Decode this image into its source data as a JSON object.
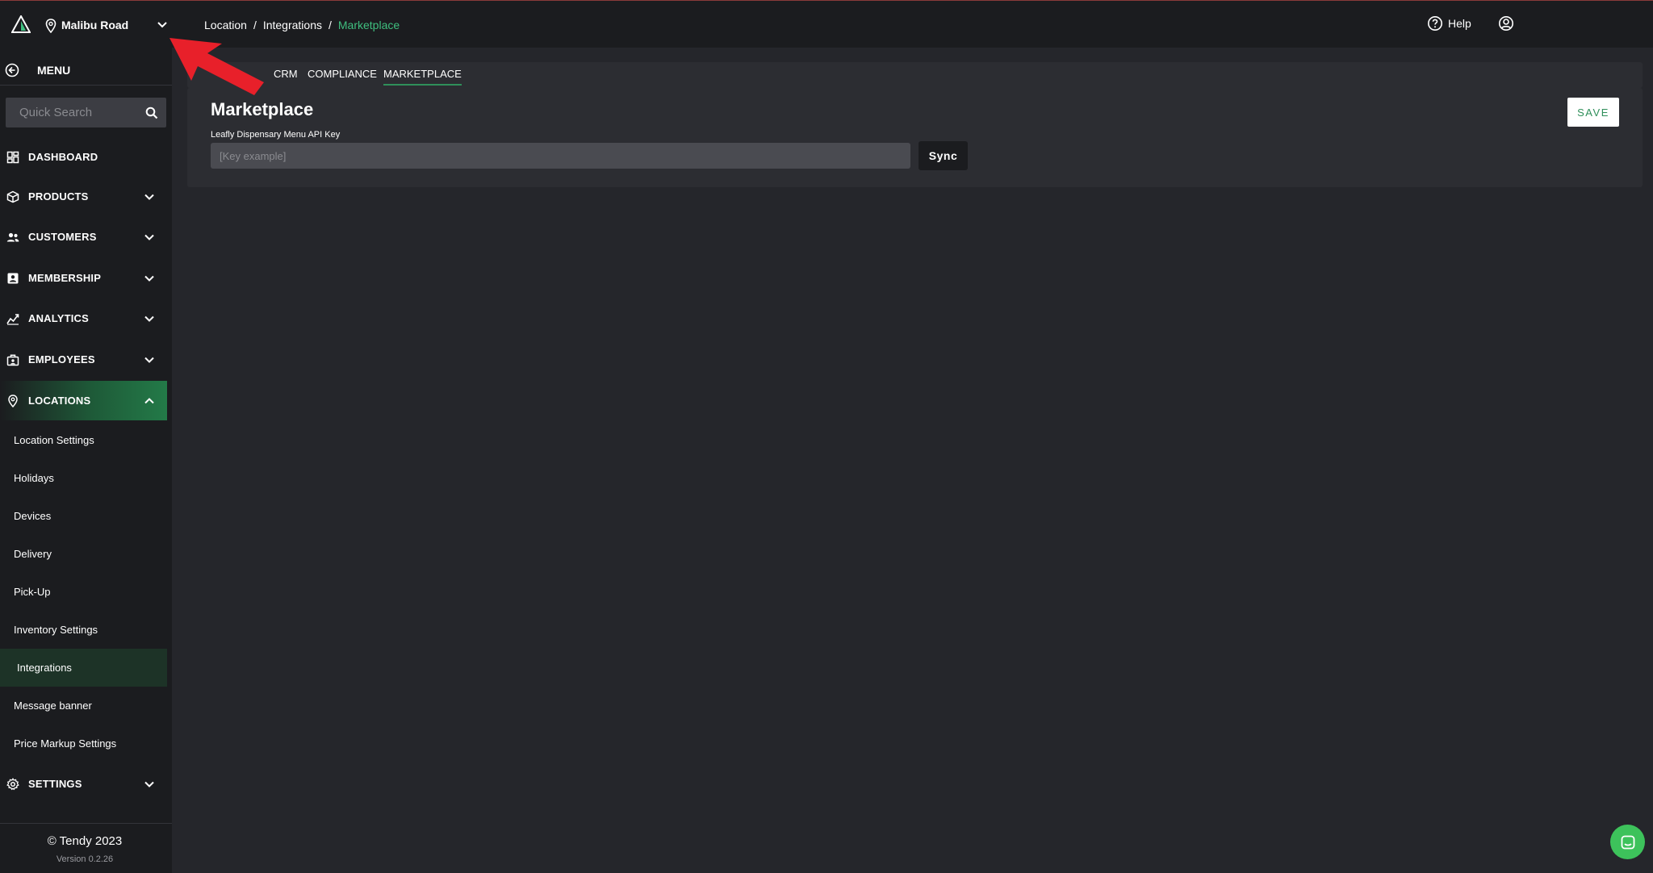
{
  "header": {
    "location_name": "Malibu Road",
    "breadcrumb": [
      "Location",
      "/",
      "Integrations",
      "/",
      "Marketplace"
    ],
    "help_label": "Help"
  },
  "sidebar": {
    "menu_label": "MENU",
    "search_placeholder": "Quick Search",
    "items": [
      {
        "label": "DASHBOARD",
        "icon": "dashboard-icon",
        "expandable": false
      },
      {
        "label": "PRODUCTS",
        "icon": "box-icon",
        "expandable": true
      },
      {
        "label": "CUSTOMERS",
        "icon": "users-icon",
        "expandable": true
      },
      {
        "label": "MEMBERSHIP",
        "icon": "id-card-icon",
        "expandable": true
      },
      {
        "label": "ANALYTICS",
        "icon": "chart-line-icon",
        "expandable": true
      },
      {
        "label": "EMPLOYEES",
        "icon": "briefcase-icon",
        "expandable": true
      },
      {
        "label": "LOCATIONS",
        "icon": "location-pin-icon",
        "expandable": true,
        "expanded": true
      }
    ],
    "sub_items": [
      "Location Settings",
      "Holidays",
      "Devices",
      "Delivery",
      "Pick-Up",
      "Inventory Settings",
      "Integrations",
      "Message banner",
      "Price Markup Settings"
    ],
    "active_sub_item": "Integrations",
    "settings_label": "SETTINGS",
    "copyright": "© Tendy 2023",
    "version": "Version 0.2.26"
  },
  "tabs": [
    "CRM",
    "COMPLIANCE",
    "MARKETPLACE"
  ],
  "active_tab": "MARKETPLACE",
  "panel": {
    "title": "Marketplace",
    "field_label": "Leafly Dispensary Menu API Key",
    "field_placeholder": "[Key example]",
    "field_value": "",
    "sync_label": "Sync",
    "save_label": "SAVE"
  },
  "colors": {
    "accent": "#2f8f5a",
    "breadcrumb_active": "#3fbf7f",
    "annotation_arrow": "#e8202a",
    "chat_button": "#3dc25b"
  }
}
